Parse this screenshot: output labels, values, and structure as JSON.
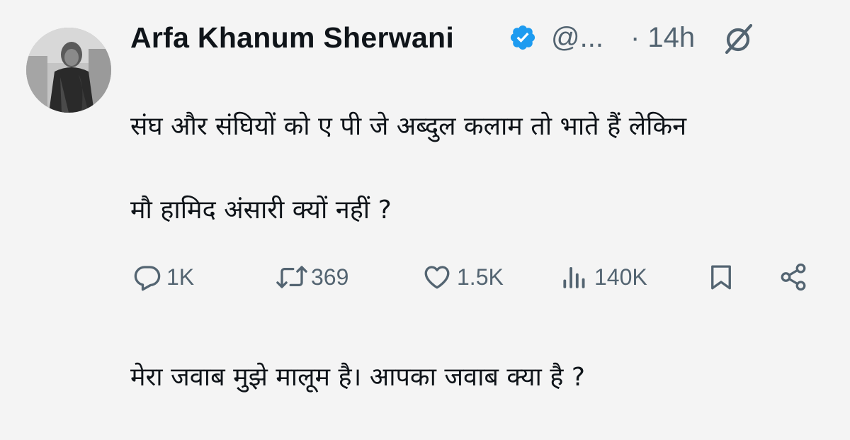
{
  "tweet": {
    "author": {
      "name": "Arfa Khanum Sherwani",
      "handle": "@...",
      "verified": true
    },
    "time": "· 14h",
    "text_line_1": "संघ और संघियों को ए पी जे अब्दुल कलाम तो भाते हैं लेकिन",
    "text_line_2": "मौ हामिद अंसारी क्यों नहीं ?",
    "text_line_3": "मेरा जवाब मुझे मालूम है। आपका जवाब क्या है ?"
  },
  "actions": {
    "replies": "1K",
    "reposts": "369",
    "likes": "1.5K",
    "views": "140K"
  },
  "icons": {
    "reply": "reply-icon",
    "repost": "repost-icon",
    "like": "heart-icon",
    "views": "views-icon",
    "bookmark": "bookmark-icon",
    "share": "share-icon",
    "grok": "grok-icon",
    "verified": "verified-badge-icon"
  },
  "colors": {
    "text": "#0f1419",
    "secondary": "#536471",
    "verified": "#1d9bf0",
    "background": "#f4f4f4"
  }
}
